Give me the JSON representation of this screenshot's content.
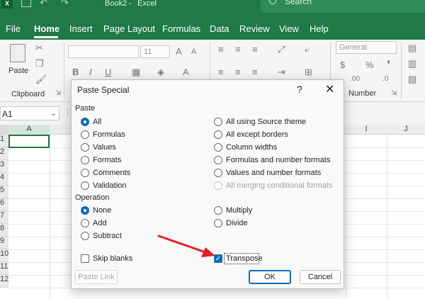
{
  "titlebar": {
    "doc_title": "Book2",
    "separator": "-",
    "app_name": "Excel",
    "search_placeholder": "Search"
  },
  "menu": [
    "File",
    "Home",
    "Insert",
    "Page Layout",
    "Formulas",
    "Data",
    "Review",
    "View",
    "Help"
  ],
  "ribbon": {
    "paste_label": "Paste",
    "clipboard_label": "Clipboard",
    "font_size": "11",
    "number_format": "General",
    "number_label": "Number",
    "percent_symbol": "%"
  },
  "namebox": {
    "value": "A1"
  },
  "columns": [
    "A",
    "I",
    "J"
  ],
  "rows": [
    "1",
    "2",
    "3",
    "4",
    "5",
    "6",
    "7",
    "8",
    "9",
    "10",
    "11",
    "12"
  ],
  "dialog": {
    "title": "Paste Special",
    "help": "?",
    "close": "✕",
    "paste_section": "Paste",
    "paste_options_left": [
      {
        "label": "All",
        "checked": true
      },
      {
        "label": "Formulas",
        "checked": false
      },
      {
        "label": "Values",
        "checked": false
      },
      {
        "label": "Formats",
        "checked": false
      },
      {
        "label": "Comments",
        "checked": false
      },
      {
        "label": "Validation",
        "checked": false
      }
    ],
    "paste_options_right": [
      {
        "label": "All using Source theme",
        "disabled": false
      },
      {
        "label": "All except borders",
        "disabled": false
      },
      {
        "label": "Column widths",
        "disabled": false
      },
      {
        "label": "Formulas and number formats",
        "disabled": false
      },
      {
        "label": "Values and number formats",
        "disabled": false
      },
      {
        "label": "All merging conditional formats",
        "disabled": true
      }
    ],
    "operation_section": "Operation",
    "operation_left": [
      {
        "label": "None",
        "checked": true
      },
      {
        "label": "Add",
        "checked": false
      },
      {
        "label": "Subtract",
        "checked": false
      }
    ],
    "operation_right": [
      {
        "label": "Multiply"
      },
      {
        "label": "Divide"
      }
    ],
    "skip_blanks": {
      "label": "Skip blanks",
      "checked": false
    },
    "transpose": {
      "label": "Transpose",
      "checked": true
    },
    "paste_link": "Paste Link",
    "ok": "OK",
    "cancel": "Cancel"
  },
  "colors": {
    "excel_green": "#1f7a45",
    "accent_blue": "#0f6cbd",
    "arrow_red": "#e02020"
  }
}
